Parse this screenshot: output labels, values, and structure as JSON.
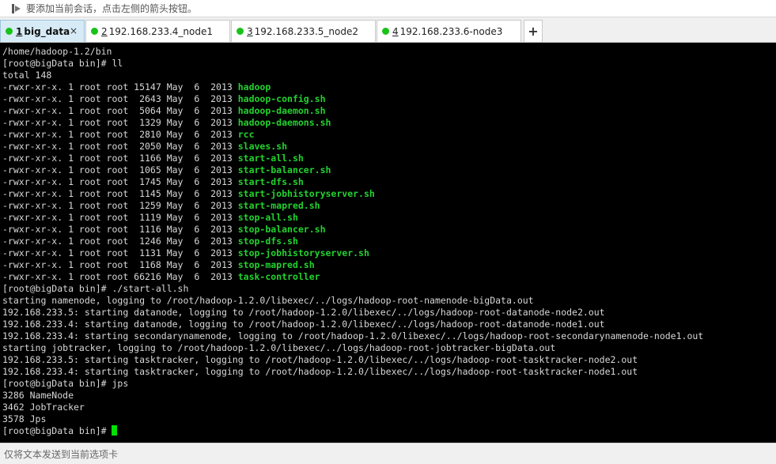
{
  "hint": {
    "text": "要添加当前会话，点击左侧的箭头按钮。",
    "icon": "arrow-pointer-icon"
  },
  "tabs": [
    {
      "num": "1",
      "label": "big_data",
      "active": true,
      "has_close": true,
      "close": "×",
      "status_color": "#19c219"
    },
    {
      "num": "2",
      "label": "192.168.233.4_node1",
      "active": false,
      "status_color": "#19c219"
    },
    {
      "num": "3",
      "label": "192.168.233.5_node2",
      "active": false,
      "status_color": "#19c219"
    },
    {
      "num": "4",
      "label": "192.168.233.6-node3",
      "active": false,
      "status_color": "#19c219"
    }
  ],
  "add_tab": "+",
  "terminal": {
    "colors": {
      "background": "#000000",
      "text": "#d8d8d8",
      "executable": "#22d22e",
      "cursor": "#00e000"
    },
    "lines": [
      {
        "text": "/home/hadoop-1.2/bin"
      },
      {
        "text": "[root@bigData bin]# ll"
      },
      {
        "text": "total 148"
      },
      {
        "text": "-rwxr-xr-x. 1 root root 15147 May  6  2013 ",
        "exec": "hadoop"
      },
      {
        "text": "-rwxr-xr-x. 1 root root  2643 May  6  2013 ",
        "exec": "hadoop-config.sh"
      },
      {
        "text": "-rwxr-xr-x. 1 root root  5064 May  6  2013 ",
        "exec": "hadoop-daemon.sh"
      },
      {
        "text": "-rwxr-xr-x. 1 root root  1329 May  6  2013 ",
        "exec": "hadoop-daemons.sh"
      },
      {
        "text": "-rwxr-xr-x. 1 root root  2810 May  6  2013 ",
        "exec": "rcc"
      },
      {
        "text": "-rwxr-xr-x. 1 root root  2050 May  6  2013 ",
        "exec": "slaves.sh"
      },
      {
        "text": "-rwxr-xr-x. 1 root root  1166 May  6  2013 ",
        "exec": "start-all.sh"
      },
      {
        "text": "-rwxr-xr-x. 1 root root  1065 May  6  2013 ",
        "exec": "start-balancer.sh"
      },
      {
        "text": "-rwxr-xr-x. 1 root root  1745 May  6  2013 ",
        "exec": "start-dfs.sh"
      },
      {
        "text": "-rwxr-xr-x. 1 root root  1145 May  6  2013 ",
        "exec": "start-jobhistoryserver.sh"
      },
      {
        "text": "-rwxr-xr-x. 1 root root  1259 May  6  2013 ",
        "exec": "start-mapred.sh"
      },
      {
        "text": "-rwxr-xr-x. 1 root root  1119 May  6  2013 ",
        "exec": "stop-all.sh"
      },
      {
        "text": "-rwxr-xr-x. 1 root root  1116 May  6  2013 ",
        "exec": "stop-balancer.sh"
      },
      {
        "text": "-rwxr-xr-x. 1 root root  1246 May  6  2013 ",
        "exec": "stop-dfs.sh"
      },
      {
        "text": "-rwxr-xr-x. 1 root root  1131 May  6  2013 ",
        "exec": "stop-jobhistoryserver.sh"
      },
      {
        "text": "-rwxr-xr-x. 1 root root  1168 May  6  2013 ",
        "exec": "stop-mapred.sh"
      },
      {
        "text": "-rwxr-xr-x. 1 root root 66216 May  6  2013 ",
        "exec": "task-controller"
      },
      {
        "text": "[root@bigData bin]# ./start-all.sh"
      },
      {
        "text": "starting namenode, logging to /root/hadoop-1.2.0/libexec/../logs/hadoop-root-namenode-bigData.out"
      },
      {
        "text": "192.168.233.5: starting datanode, logging to /root/hadoop-1.2.0/libexec/../logs/hadoop-root-datanode-node2.out"
      },
      {
        "text": "192.168.233.4: starting datanode, logging to /root/hadoop-1.2.0/libexec/../logs/hadoop-root-datanode-node1.out"
      },
      {
        "text": "192.168.233.4: starting secondarynamenode, logging to /root/hadoop-1.2.0/libexec/../logs/hadoop-root-secondarynamenode-node1.out"
      },
      {
        "text": "starting jobtracker, logging to /root/hadoop-1.2.0/libexec/../logs/hadoop-root-jobtracker-bigData.out"
      },
      {
        "text": "192.168.233.5: starting tasktracker, logging to /root/hadoop-1.2.0/libexec/../logs/hadoop-root-tasktracker-node2.out"
      },
      {
        "text": "192.168.233.4: starting tasktracker, logging to /root/hadoop-1.2.0/libexec/../logs/hadoop-root-tasktracker-node1.out"
      },
      {
        "text": "[root@bigData bin]# jps"
      },
      {
        "text": "3286 NameNode"
      },
      {
        "text": "3462 JobTracker"
      },
      {
        "text": "3578 Jps"
      },
      {
        "text": "[root@bigData bin]# ",
        "cursor": true
      }
    ]
  },
  "status": {
    "text": "仅将文本发送到当前选项卡"
  }
}
